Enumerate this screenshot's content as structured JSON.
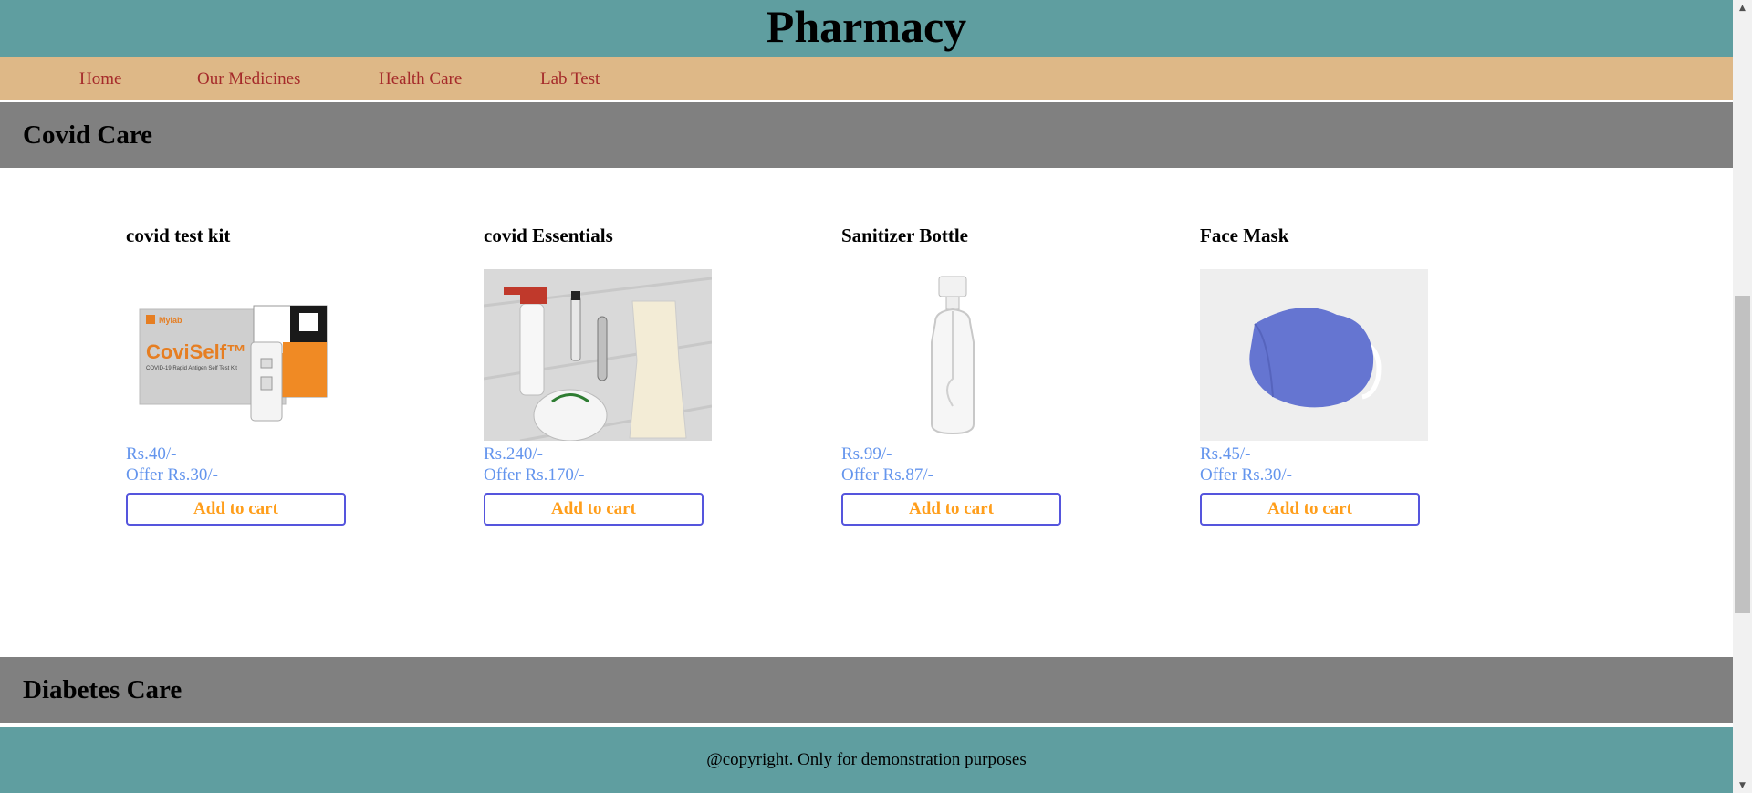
{
  "header": {
    "title": "Pharmacy"
  },
  "nav": {
    "items": [
      {
        "label": "Home"
      },
      {
        "label": "Our Medicines"
      },
      {
        "label": "Health Care"
      },
      {
        "label": "Lab Test"
      }
    ]
  },
  "covid_section": {
    "title": "Covid Care",
    "products": [
      {
        "name": "covid test kit",
        "price": "Rs.40/-",
        "offer": "Offer Rs.30/-",
        "button": "Add to cart",
        "image_brand": "Mylab",
        "image_title": "CoviSelf™",
        "image_caption": "COVID-19 Rapid Antigen Self Test Kit"
      },
      {
        "name": "covid Essentials",
        "price": "Rs.240/-",
        "offer": "Offer Rs.170/-",
        "button": "Add to cart"
      },
      {
        "name": "Sanitizer Bottle",
        "price": "Rs.99/-",
        "offer": "Offer Rs.87/-",
        "button": "Add to cart"
      },
      {
        "name": "Face Mask",
        "price": "Rs.45/-",
        "offer": "Offer Rs.30/-",
        "button": "Add to cart"
      }
    ]
  },
  "diabetes_section": {
    "title": "Diabetes Care"
  },
  "footer": {
    "text": "@copyright. Only for demonstration purposes"
  },
  "colors": {
    "header_bg": "#5f9ea0",
    "nav_bg": "#deb887",
    "nav_link": "#a52a2a",
    "section_bg": "#808080",
    "price": "#6495ed",
    "button_text": "#ff9e1b",
    "button_border": "#5555dd"
  },
  "icons": {
    "scroll_up": "triangle-up-icon",
    "scroll_down": "triangle-down-icon"
  }
}
